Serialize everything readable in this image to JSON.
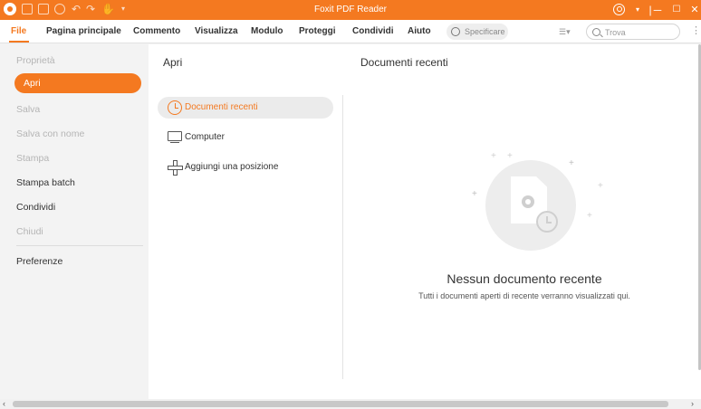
{
  "window": {
    "title": "Foxit PDF Reader",
    "controls": {
      "minimize": "─",
      "maximize": "☐",
      "close": "✕"
    }
  },
  "menu": {
    "items": [
      {
        "label": "File",
        "active": true
      },
      {
        "label": "Pagina principale"
      },
      {
        "label": "Commento"
      },
      {
        "label": "Visualizza"
      },
      {
        "label": "Modulo"
      },
      {
        "label": "Proteggi"
      },
      {
        "label": "Condividi"
      },
      {
        "label": "Aiuto"
      }
    ],
    "tellme_placeholder": "Specificare",
    "search_placeholder": "Trova"
  },
  "sidebar": {
    "items": [
      {
        "label": "Proprietà",
        "state": "disabled"
      },
      {
        "label": "Apri",
        "state": "active"
      },
      {
        "label": "Salva",
        "state": "disabled"
      },
      {
        "label": "Salva con nome",
        "state": "disabled"
      },
      {
        "label": "Stampa",
        "state": "disabled"
      },
      {
        "label": "Stampa batch",
        "state": "enabled"
      },
      {
        "label": "Condividi",
        "state": "enabled"
      },
      {
        "label": "Chiudi",
        "state": "disabled"
      },
      {
        "label": "Preferenze",
        "state": "enabled"
      }
    ]
  },
  "open_pane": {
    "title": "Apri",
    "locations": [
      {
        "label": "Documenti recenti",
        "icon": "clock-icon",
        "selected": true
      },
      {
        "label": "Computer",
        "icon": "computer-icon"
      },
      {
        "label": "Aggiungi una posizione",
        "icon": "plus-icon"
      }
    ]
  },
  "recent_pane": {
    "title": "Documenti recenti",
    "empty_title": "Nessun documento recente",
    "empty_subtitle": "Tutti i documenti aperti di recente verranno visualizzati qui."
  },
  "colors": {
    "accent": "#f47920",
    "selected_bg": "#ebebeb",
    "backstage_bg": "#f3f3f3"
  }
}
